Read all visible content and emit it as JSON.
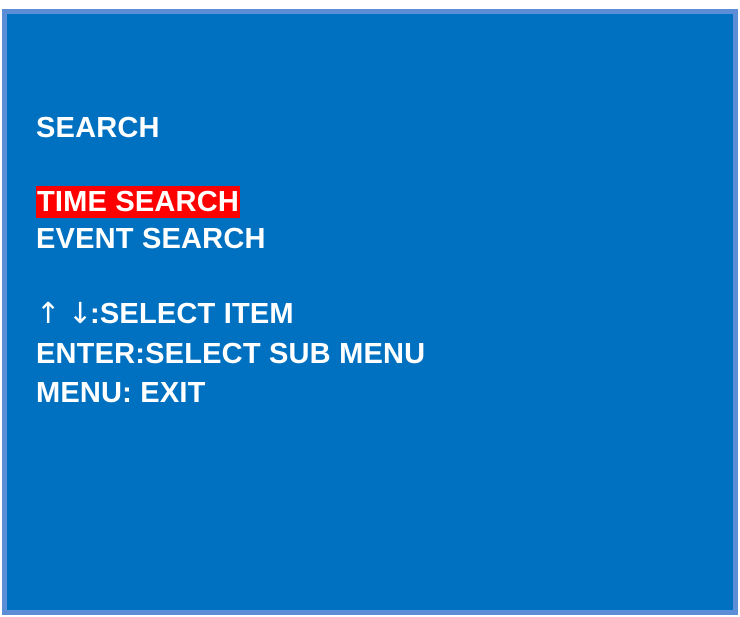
{
  "menu": {
    "title": "SEARCH",
    "items": [
      {
        "label": "TIME SEARCH",
        "selected": true
      },
      {
        "label": "EVENT SEARCH",
        "selected": false
      }
    ],
    "highlight_color": "#ff0000"
  },
  "hints": {
    "select_item": {
      "icons": [
        "up-arrow-icon",
        "down-arrow-icon"
      ],
      "up_glyph": "↑",
      "down_glyph": "↓",
      "text": ":SELECT ITEM"
    },
    "enter": "ENTER:SELECT SUB MENU",
    "exit": "MENU: EXIT"
  },
  "colors": {
    "background": "#0070c0",
    "border": "#5b8ed6",
    "text": "#ffffff"
  }
}
